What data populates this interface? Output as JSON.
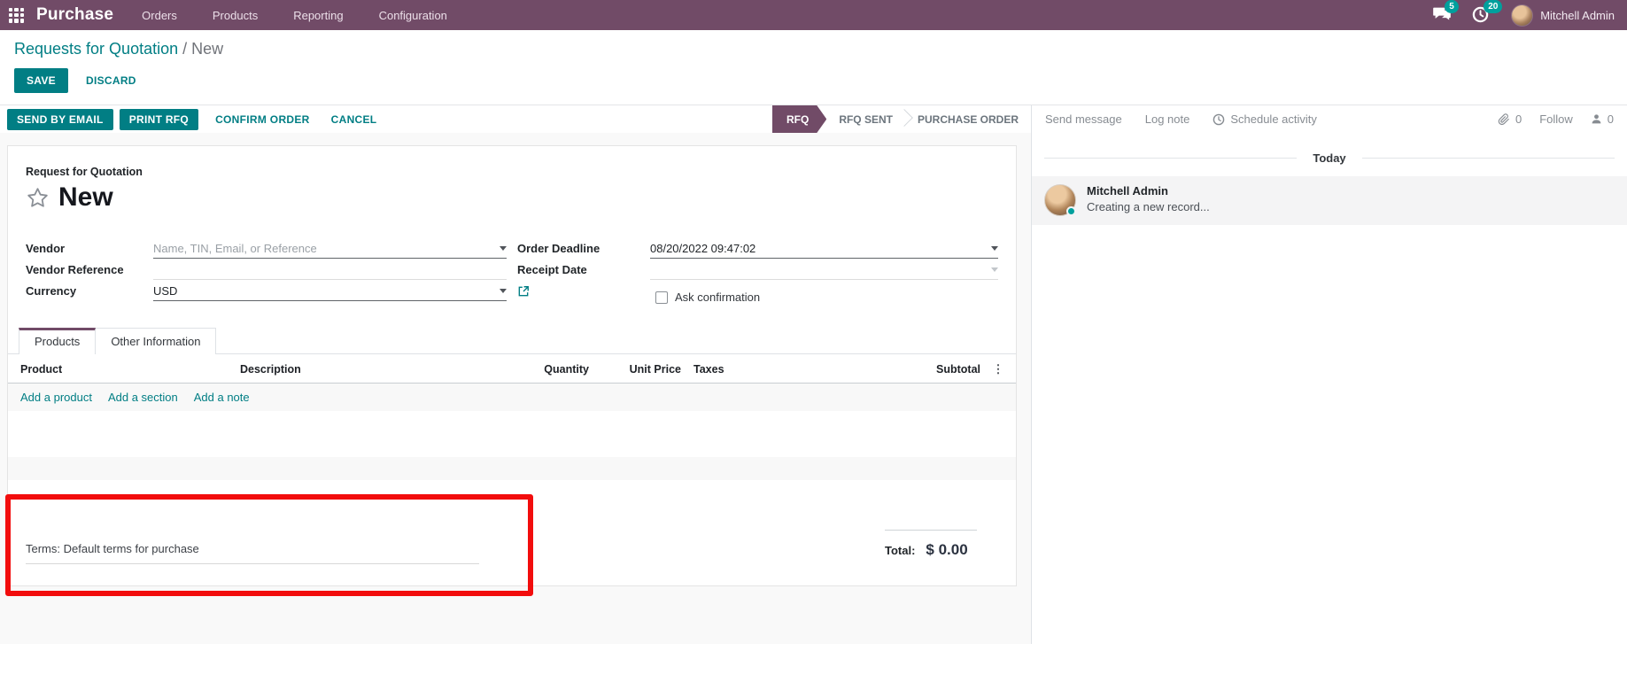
{
  "topbar": {
    "app_name": "Purchase",
    "menu": [
      {
        "label": "Orders"
      },
      {
        "label": "Products"
      },
      {
        "label": "Reporting"
      },
      {
        "label": "Configuration"
      }
    ],
    "messages_badge": "5",
    "activities_badge": "20",
    "user_name": "Mitchell Admin"
  },
  "breadcrumb": {
    "parent": "Requests for Quotation",
    "separator": "/",
    "current": "New"
  },
  "actions": {
    "save": "SAVE",
    "discard": "DISCARD",
    "send_by_email": "SEND BY EMAIL",
    "print_rfq": "PRINT RFQ",
    "confirm_order": "CONFIRM ORDER",
    "cancel": "CANCEL"
  },
  "statusbar": {
    "stages": [
      {
        "label": "RFQ"
      },
      {
        "label": "RFQ SENT"
      },
      {
        "label": "PURCHASE ORDER"
      }
    ],
    "active_stage": "RFQ"
  },
  "chatter": {
    "send_message": "Send message",
    "log_note": "Log note",
    "schedule_activity": "Schedule activity",
    "attachment_count": "0",
    "follow": "Follow",
    "follower_count": "0",
    "today": "Today",
    "message": {
      "author": "Mitchell Admin",
      "body": "Creating a new record..."
    }
  },
  "form": {
    "doc_type_label": "Request for Quotation",
    "title": "New",
    "fields": {
      "vendor_label": "Vendor",
      "vendor_placeholder": "Name, TIN, Email, or Reference",
      "vendor_reference_label": "Vendor Reference",
      "currency_label": "Currency",
      "currency_value": "USD",
      "order_deadline_label": "Order Deadline",
      "order_deadline_value": "08/20/2022 09:47:02",
      "receipt_date_label": "Receipt Date",
      "ask_confirmation_label": "Ask confirmation"
    },
    "tabs": [
      {
        "label": "Products"
      },
      {
        "label": "Other Information"
      }
    ],
    "table": {
      "headers": [
        "Product",
        "Description",
        "Quantity",
        "Unit Price",
        "Taxes",
        "Subtotal"
      ],
      "add_links": [
        "Add a product",
        "Add a section",
        "Add a note"
      ]
    },
    "terms": "Terms: Default terms for purchase",
    "total_label": "Total:",
    "total_value": "$ 0.00"
  },
  "colors": {
    "brand_purple": "#714B67",
    "accent_teal": "#017E84",
    "badge_teal": "#00A09D",
    "annotation_red": "#F20D0D"
  }
}
